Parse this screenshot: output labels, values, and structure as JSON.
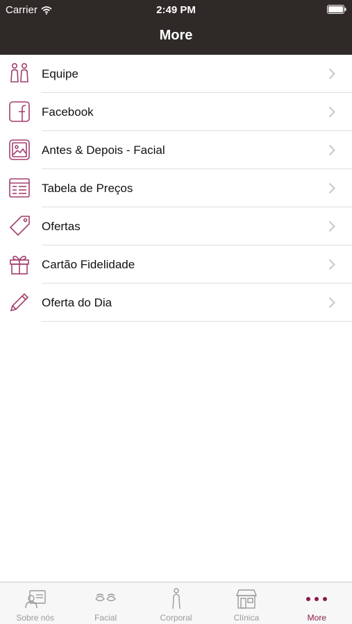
{
  "status": {
    "carrier": "Carrier",
    "time": "2:49 PM"
  },
  "nav": {
    "title": "More"
  },
  "accent": "#a33d6e",
  "items": [
    {
      "label": "Equipe",
      "icon": "people-icon"
    },
    {
      "label": "Facebook",
      "icon": "facebook-icon"
    },
    {
      "label": "Antes & Depois - Facial",
      "icon": "photo-icon"
    },
    {
      "label": "Tabela de Preços",
      "icon": "price-list-icon"
    },
    {
      "label": "Ofertas",
      "icon": "tag-icon"
    },
    {
      "label": "Cartão Fidelidade",
      "icon": "gift-icon"
    },
    {
      "label": "Oferta do Dia",
      "icon": "pencil-icon"
    }
  ],
  "tabs": [
    {
      "label": "Sobre nós",
      "icon": "profile-card-icon"
    },
    {
      "label": "Facial",
      "icon": "face-icon"
    },
    {
      "label": "Corporal",
      "icon": "body-icon"
    },
    {
      "label": "Clínica",
      "icon": "store-icon"
    },
    {
      "label": "More",
      "icon": "more-dots-icon",
      "active": true
    }
  ]
}
